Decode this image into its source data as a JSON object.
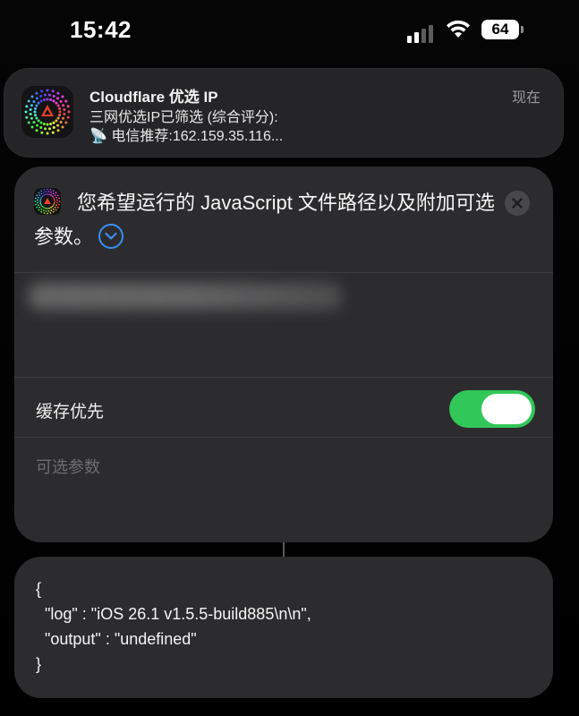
{
  "status_bar": {
    "time": "15:42",
    "battery": "64",
    "icons": [
      "cellular-signal-icon",
      "wifi-icon",
      "battery-icon"
    ]
  },
  "notification": {
    "app_icon": "cloudflare-app-icon",
    "title": "Cloudflare 优选 IP",
    "line1": "三网优选IP已筛选 (综合评分):",
    "line2_icon": "satellite-dish-emoji",
    "line2_emoji": "📡",
    "line2": "电信推荐:162.159.35.116...",
    "time": "现在"
  },
  "prompt": {
    "title": "您希望运行的 JavaScript 文件路径以及附加可选参数。",
    "expand_icon": "chevron-down-icon",
    "close_icon": "close-icon",
    "cache_label": "缓存优先",
    "cache_enabled": true,
    "optional_params_placeholder": "可选参数"
  },
  "output": {
    "text": "{\n  \"log\" : \"iOS 26.1 v1.5.5-build885\\n\\n\",\n  \"output\" : \"undefined\"\n}"
  },
  "colors": {
    "background": "#000000",
    "card": "#2c2c2e",
    "toggle_on": "#32c759",
    "accent": "#3a8ef0"
  }
}
